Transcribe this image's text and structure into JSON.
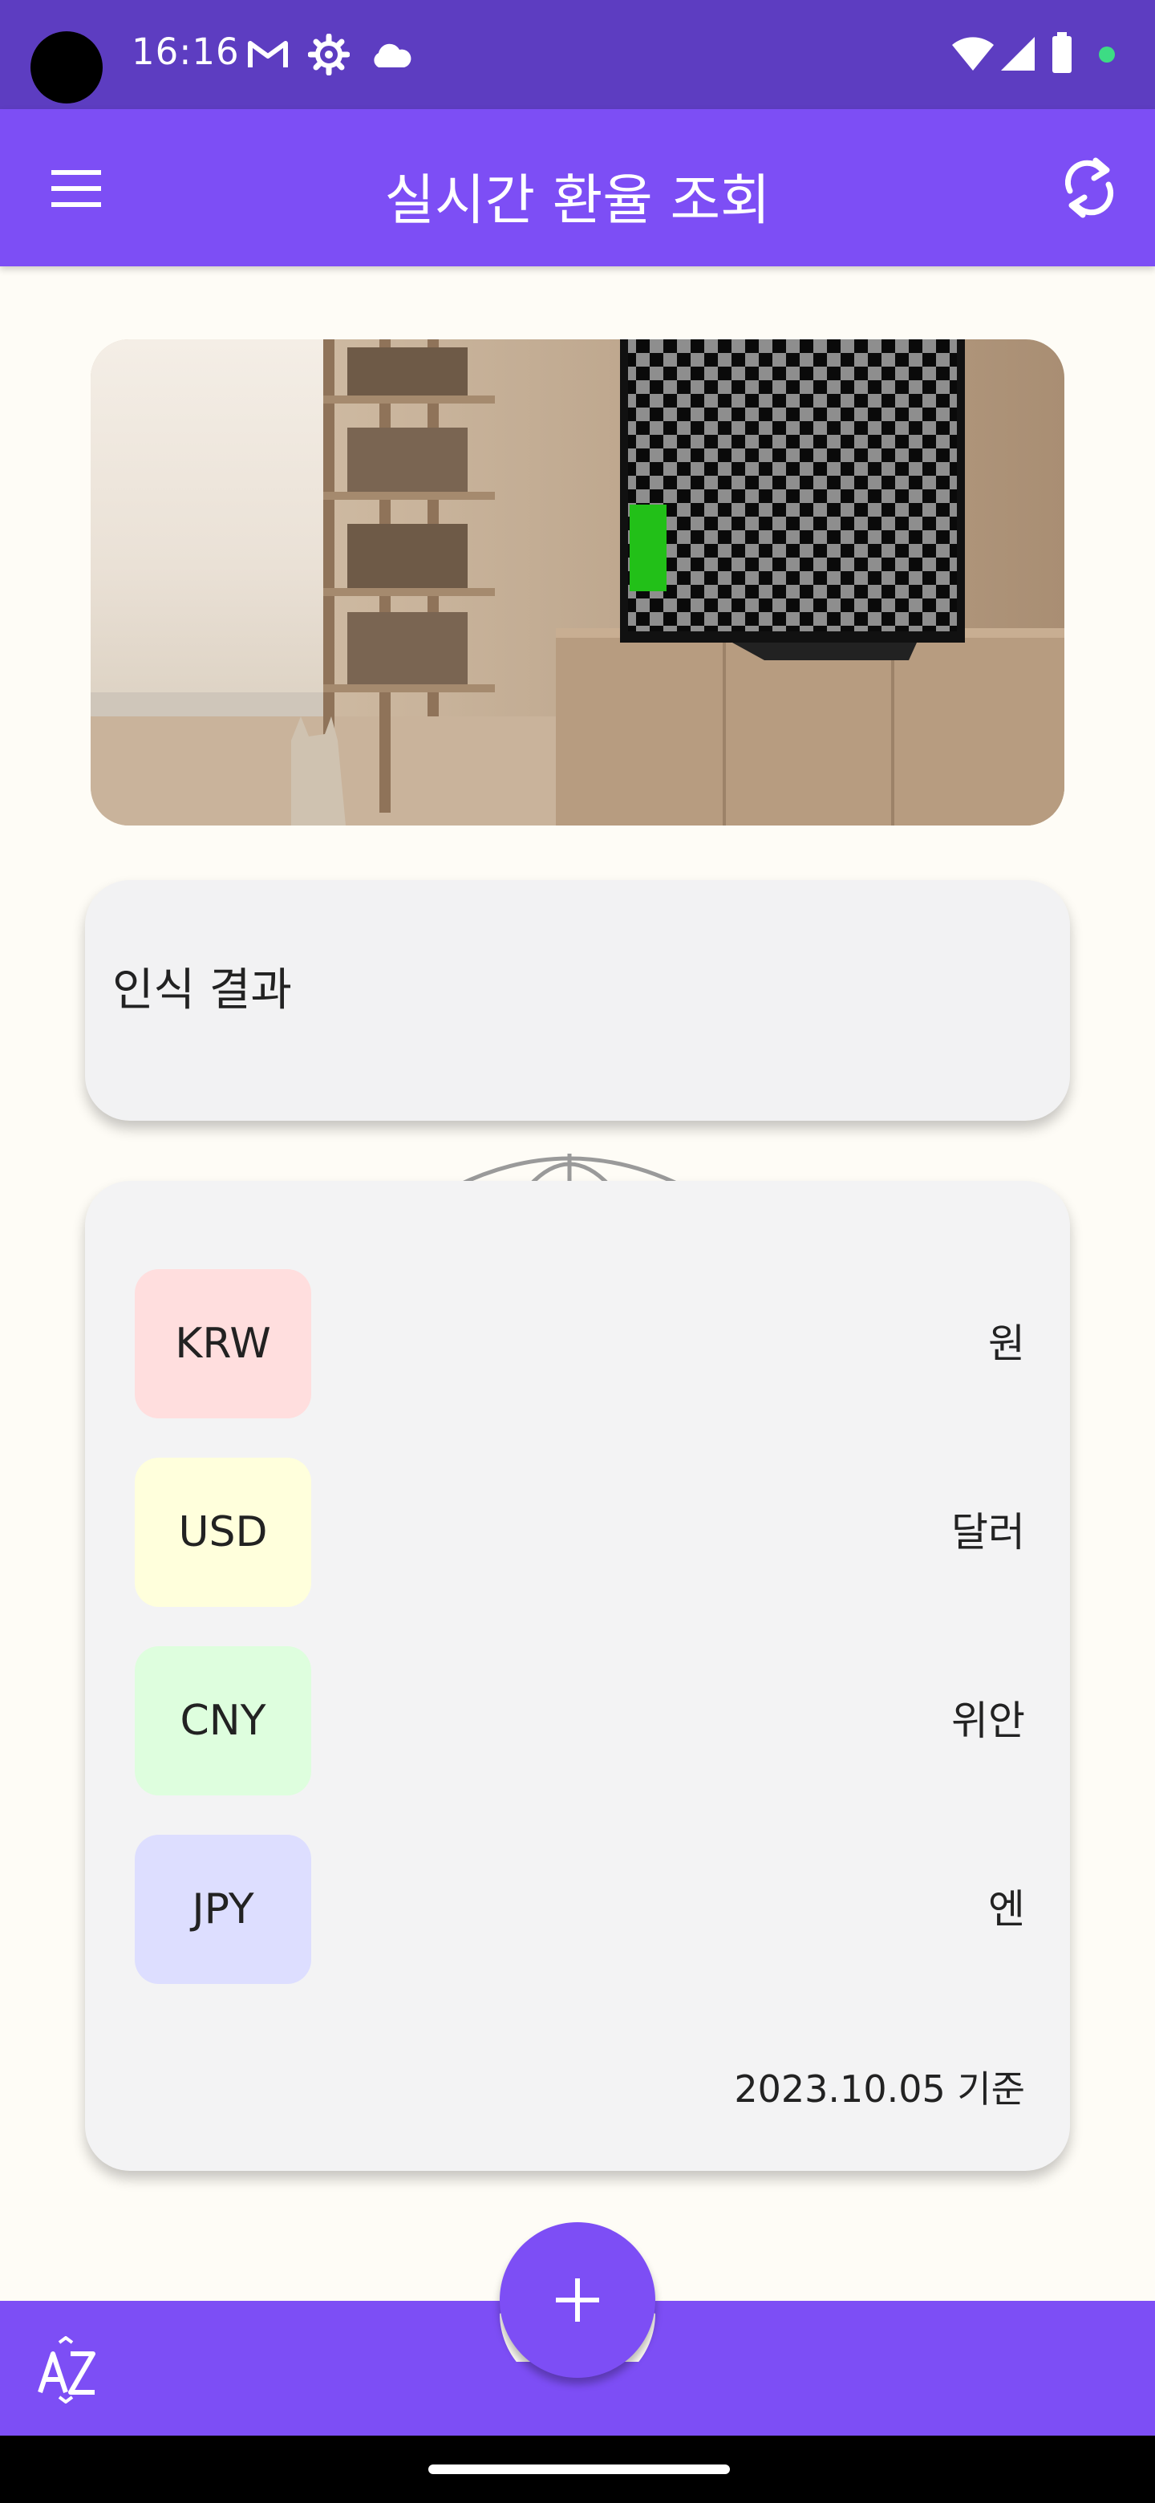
{
  "status_bar": {
    "time": "16:16",
    "icons": [
      "gmail-icon",
      "settings-gear-icon",
      "cloud-icon",
      "wifi-icon",
      "cellular-signal-icon",
      "battery-icon",
      "privacy-indicator-dot"
    ],
    "indicator_color": "#3DDC84"
  },
  "app_bar": {
    "title": "실시간 환율 조회",
    "menu_icon": "hamburger-menu-icon",
    "refresh_icon": "refresh-icon",
    "color": "#7D4EF5"
  },
  "hero": {
    "icon": "room-scene-image"
  },
  "result": {
    "title": "인식 결과"
  },
  "currencies": [
    {
      "code": "KRW",
      "name": "원",
      "color": "#FFDEDE"
    },
    {
      "code": "USD",
      "name": "달러",
      "color": "#FFFFDC"
    },
    {
      "code": "CNY",
      "name": "위안",
      "color": "#DEFEDE"
    },
    {
      "code": "JPY",
      "name": "엔",
      "color": "#DDDEFF"
    }
  ],
  "basis_date": "2023.10.05 기준",
  "bottom_bar": {
    "sort_icon": "sort-az-icon",
    "fab_icon": "plus-icon",
    "fab_label": "+"
  }
}
